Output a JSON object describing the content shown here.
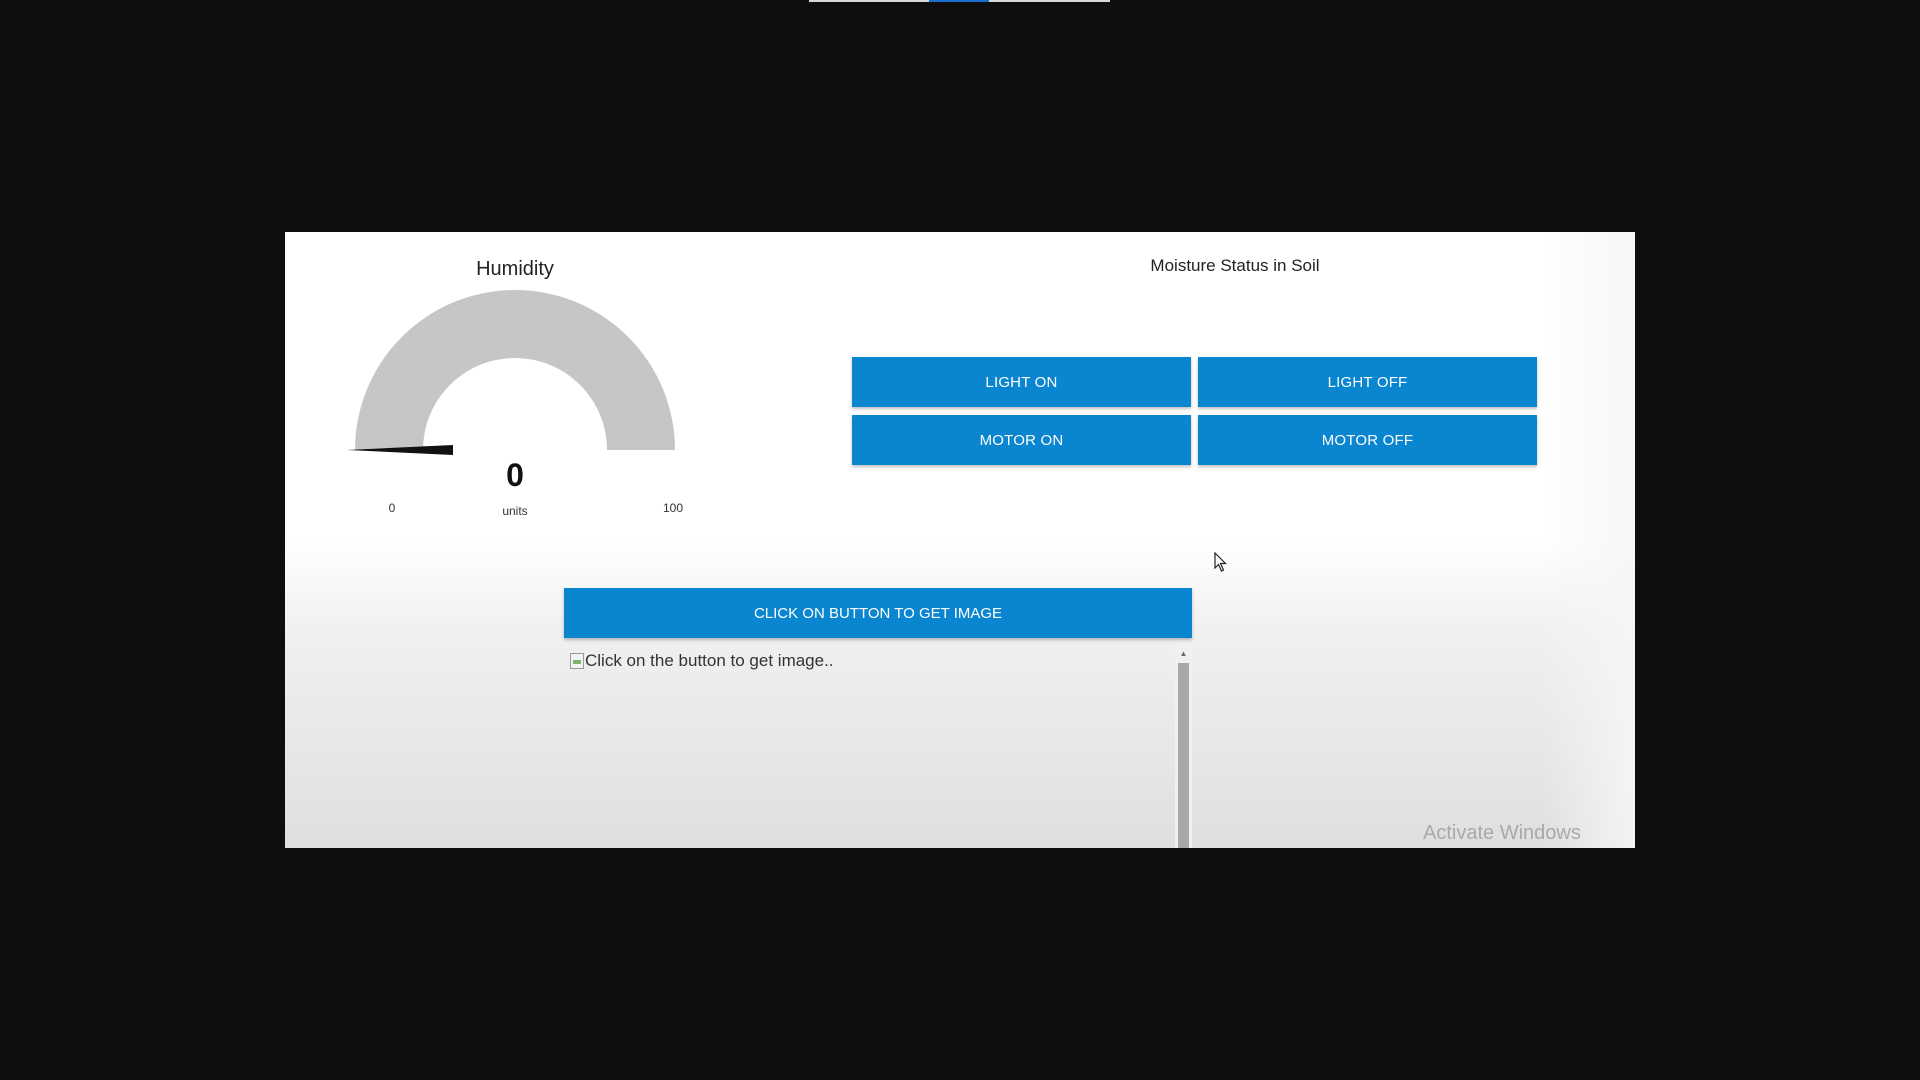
{
  "gauge": {
    "title": "Humidity",
    "value": "0",
    "units": "units",
    "min": "0",
    "max": "100",
    "level_percent": 0,
    "track_color": "#c6c6c6"
  },
  "controls": {
    "section_title": "Moisture Status in Soil",
    "buttons": [
      {
        "label": "LIGHT ON"
      },
      {
        "label": "LIGHT OFF"
      },
      {
        "label": "MOTOR ON"
      },
      {
        "label": "MOTOR OFF"
      }
    ],
    "accent_color": "#0a85d0"
  },
  "image_panel": {
    "button_label": "CLICK ON BUTTON TO GET IMAGE",
    "image_alt": "Click on the button to get image.."
  },
  "watermark": "Activate Windows"
}
